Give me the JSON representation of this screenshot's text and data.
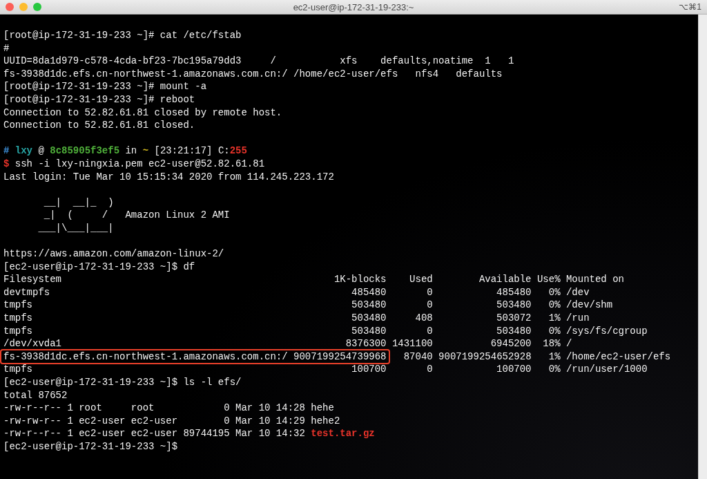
{
  "window": {
    "title": "ec2-user@ip-172-31-19-233:~",
    "shortcut": "⌥⌘1"
  },
  "terminal": {
    "lines": [
      {
        "kind": "text",
        "segments": [
          {
            "text": "[root@ip-172-31-19-233 ~]# cat /etc/fstab"
          }
        ]
      },
      {
        "kind": "text",
        "segments": [
          {
            "text": "#"
          }
        ]
      },
      {
        "kind": "text",
        "segments": [
          {
            "text": "UUID=8da1d979-c578-4cda-bf23-7bc195a79dd3     /           xfs    defaults,noatime  1   1"
          }
        ]
      },
      {
        "kind": "text",
        "segments": [
          {
            "text": "fs-3938d1dc.efs.cn-northwest-1.amazonaws.com.cn:/ /home/ec2-user/efs   nfs4   defaults"
          }
        ]
      },
      {
        "kind": "text",
        "segments": [
          {
            "text": "[root@ip-172-31-19-233 ~]# mount -a"
          }
        ]
      },
      {
        "kind": "text",
        "segments": [
          {
            "text": "[root@ip-172-31-19-233 ~]# reboot"
          }
        ]
      },
      {
        "kind": "text",
        "segments": [
          {
            "text": "Connection to 52.82.61.81 closed by remote host."
          }
        ]
      },
      {
        "kind": "text",
        "segments": [
          {
            "text": "Connection to 52.82.61.81 closed."
          }
        ]
      },
      {
        "kind": "blank"
      },
      {
        "kind": "text",
        "segments": [
          {
            "text": "#",
            "color": "#3d8fd8"
          },
          {
            "text": " lxy",
            "color": "#27a6a6"
          },
          {
            "text": " @ "
          },
          {
            "text": "8c85905f3ef5",
            "color": "#4fb03a"
          },
          {
            "text": " in "
          },
          {
            "text": "~",
            "color": "#d2b81e"
          },
          {
            "text": " [23:21:17] C:"
          },
          {
            "text": "255",
            "color": "#e8332a"
          }
        ]
      },
      {
        "kind": "text",
        "segments": [
          {
            "text": "$",
            "color": "#e8332a"
          },
          {
            "text": " ssh -i lxy-ningxia.pem ec2-user@52.82.61.81"
          }
        ]
      },
      {
        "kind": "text",
        "segments": [
          {
            "text": "Last login: Tue Mar 10 15:15:34 2020 from 114.245.223.172"
          }
        ]
      },
      {
        "kind": "blank"
      },
      {
        "kind": "text",
        "segments": [
          {
            "text": "       __|  __|_  )"
          }
        ]
      },
      {
        "kind": "text",
        "segments": [
          {
            "text": "       _|  (     /   Amazon Linux 2 AMI"
          }
        ]
      },
      {
        "kind": "text",
        "segments": [
          {
            "text": "      ___|\\___|___|"
          }
        ]
      },
      {
        "kind": "blank"
      },
      {
        "kind": "text",
        "segments": [
          {
            "text": "https://aws.amazon.com/amazon-linux-2/"
          }
        ]
      },
      {
        "kind": "text",
        "segments": [
          {
            "text": "[ec2-user@ip-172-31-19-233 ~]$ df"
          }
        ]
      },
      {
        "kind": "text",
        "segments": [
          {
            "text": "Filesystem                                               1K-blocks    Used        Available Use% Mounted on"
          }
        ]
      },
      {
        "kind": "text",
        "segments": [
          {
            "text": "devtmpfs                                                    485480       0           485480   0% /dev"
          }
        ]
      },
      {
        "kind": "text",
        "segments": [
          {
            "text": "tmpfs                                                       503480       0           503480   0% /dev/shm"
          }
        ]
      },
      {
        "kind": "text",
        "segments": [
          {
            "text": "tmpfs                                                       503480     408           503072   1% /run"
          }
        ]
      },
      {
        "kind": "text",
        "segments": [
          {
            "text": "tmpfs                                                       503480       0           503480   0% /sys/fs/cgroup"
          }
        ]
      },
      {
        "kind": "text",
        "segments": [
          {
            "text": "/dev/xvda1                                                 8376300 1431100          6945200  18% /"
          }
        ]
      },
      {
        "kind": "text",
        "segments": [
          {
            "text": "fs-3938d1dc.efs.cn-northwest-1.amazonaws.com.cn:/ 9007199254739968",
            "boxed": true
          },
          {
            "text": "   87040 9007199254652928   1% /home/ec2-user/efs",
            "boxed": false
          }
        ]
      },
      {
        "kind": "text",
        "segments": [
          {
            "text": "tmpfs                                                       100700       0           100700   0% /run/user/1000"
          }
        ]
      },
      {
        "kind": "text",
        "segments": [
          {
            "text": "[ec2-user@ip-172-31-19-233 ~]$ ls -l efs/"
          }
        ]
      },
      {
        "kind": "text",
        "segments": [
          {
            "text": "total 87652"
          }
        ]
      },
      {
        "kind": "text",
        "segments": [
          {
            "text": "-rw-r--r-- 1 root     root            0 Mar 10 14:28 hehe"
          }
        ]
      },
      {
        "kind": "text",
        "segments": [
          {
            "text": "-rw-rw-r-- 1 ec2-user ec2-user        0 Mar 10 14:29 hehe2"
          }
        ]
      },
      {
        "kind": "text",
        "segments": [
          {
            "text": "-rw-r--r-- 1 ec2-user ec2-user 89744195 Mar 10 14:32 "
          },
          {
            "text": "test.tar.gz",
            "color": "#e8332a"
          }
        ]
      },
      {
        "kind": "text",
        "segments": [
          {
            "text": "[ec2-user@ip-172-31-19-233 ~]$"
          }
        ]
      }
    ]
  }
}
